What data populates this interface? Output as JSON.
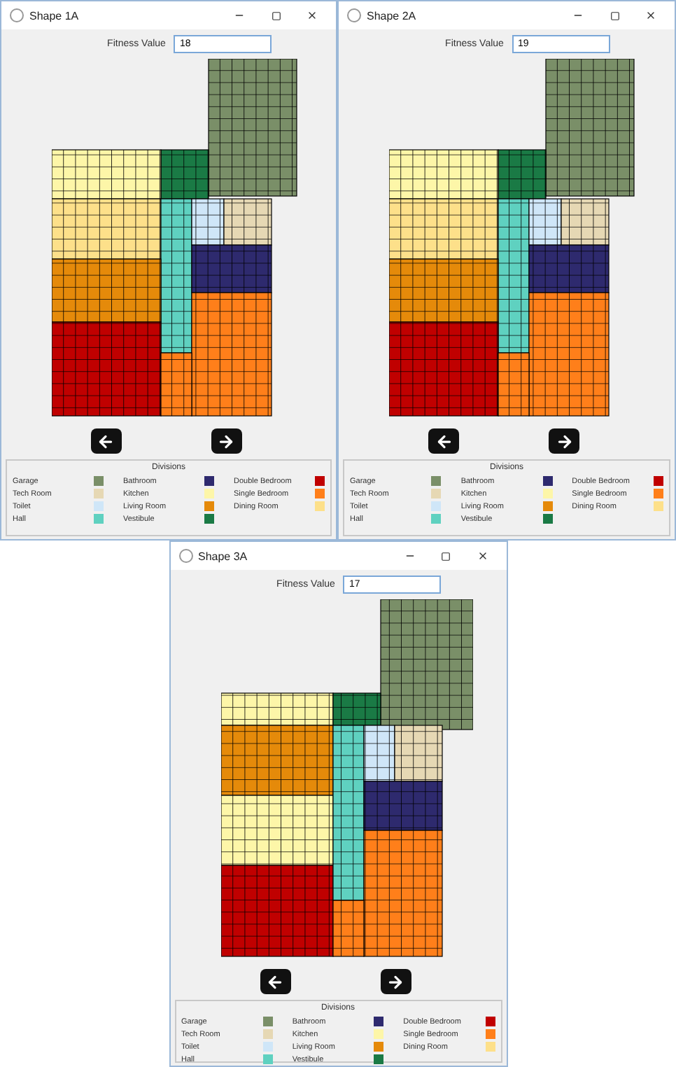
{
  "windows": [
    {
      "title": "Shape 1A",
      "fitness_label": "Fitness Value",
      "fitness_value": "18",
      "legend_title": "Divisions",
      "legend": [
        {
          "label": "Garage",
          "color": "#7a8f68"
        },
        {
          "label": "Tech Room",
          "color": "#e6d8b4"
        },
        {
          "label": "Toilet",
          "color": "#cfe6f8"
        },
        {
          "label": "Hall",
          "color": "#5fd1c0"
        },
        {
          "label": "Bathroom",
          "color": "#2e2a6e"
        },
        {
          "label": "Kitchen",
          "color": "#fdf6a8"
        },
        {
          "label": "Living Room",
          "color": "#e58a0a"
        },
        {
          "label": "Vestibule",
          "color": "#1a7a45"
        },
        {
          "label": "Double Bedroom",
          "color": "#c00000"
        },
        {
          "label": "Single Bedroom",
          "color": "#ff7f1a"
        },
        {
          "label": "Dining Room",
          "color": "#fde08a"
        }
      ]
    },
    {
      "title": "Shape 2A",
      "fitness_label": "Fitness Value",
      "fitness_value": "19",
      "legend_title": "Divisions",
      "legend": [
        {
          "label": "Garage",
          "color": "#7a8f68"
        },
        {
          "label": "Tech Room",
          "color": "#e6d8b4"
        },
        {
          "label": "Toilet",
          "color": "#cfe6f8"
        },
        {
          "label": "Hall",
          "color": "#5fd1c0"
        },
        {
          "label": "Bathroom",
          "color": "#2e2a6e"
        },
        {
          "label": "Kitchen",
          "color": "#fdf6a8"
        },
        {
          "label": "Living Room",
          "color": "#e58a0a"
        },
        {
          "label": "Vestibule",
          "color": "#1a7a45"
        },
        {
          "label": "Double Bedroom",
          "color": "#c00000"
        },
        {
          "label": "Single Bedroom",
          "color": "#ff7f1a"
        },
        {
          "label": "Dining Room",
          "color": "#fde08a"
        }
      ]
    },
    {
      "title": "Shape 3A",
      "fitness_label": "Fitness Value",
      "fitness_value": "17",
      "legend_title": "Divisions",
      "legend": [
        {
          "label": "Garage",
          "color": "#7a8f68"
        },
        {
          "label": "Tech Room",
          "color": "#e6d8b4"
        },
        {
          "label": "Toilet",
          "color": "#cfe6f8"
        },
        {
          "label": "Hall",
          "color": "#5fd1c0"
        },
        {
          "label": "Bathroom",
          "color": "#2e2a6e"
        },
        {
          "label": "Kitchen",
          "color": "#fdf6a8"
        },
        {
          "label": "Living Room",
          "color": "#e58a0a"
        },
        {
          "label": "Vestibule",
          "color": "#1a7a45"
        },
        {
          "label": "Double Bedroom",
          "color": "#c00000"
        },
        {
          "label": "Single Bedroom",
          "color": "#ff7f1a"
        },
        {
          "label": "Dining Room",
          "color": "#fde08a"
        }
      ]
    }
  ]
}
